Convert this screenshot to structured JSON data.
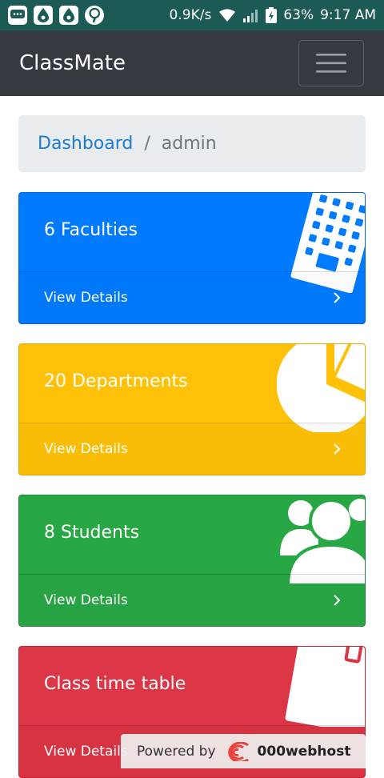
{
  "status_bar": {
    "network_speed": "0.9K/s",
    "battery": "63%",
    "time": "9:17 AM"
  },
  "navbar": {
    "brand": "ClassMate",
    "toggle_icon": "hamburger-icon"
  },
  "breadcrumb": {
    "link": "Dashboard",
    "separator": "/",
    "current": "admin"
  },
  "cards": [
    {
      "title": "6 Faculties",
      "footer": "View Details",
      "icon": "building-icon",
      "color": "#007bff"
    },
    {
      "title": "20 Departments",
      "footer": "View Details",
      "icon": "pie-chart-icon",
      "color": "#ffc107"
    },
    {
      "title": "8 Students",
      "footer": "View Details",
      "icon": "users-icon",
      "color": "#28a745"
    },
    {
      "title": "Class time table",
      "footer": "View Details",
      "icon": "calendar-icon",
      "color": "#dc3545"
    }
  ],
  "powered_by": {
    "label": "Powered by",
    "host": "000webhost"
  }
}
